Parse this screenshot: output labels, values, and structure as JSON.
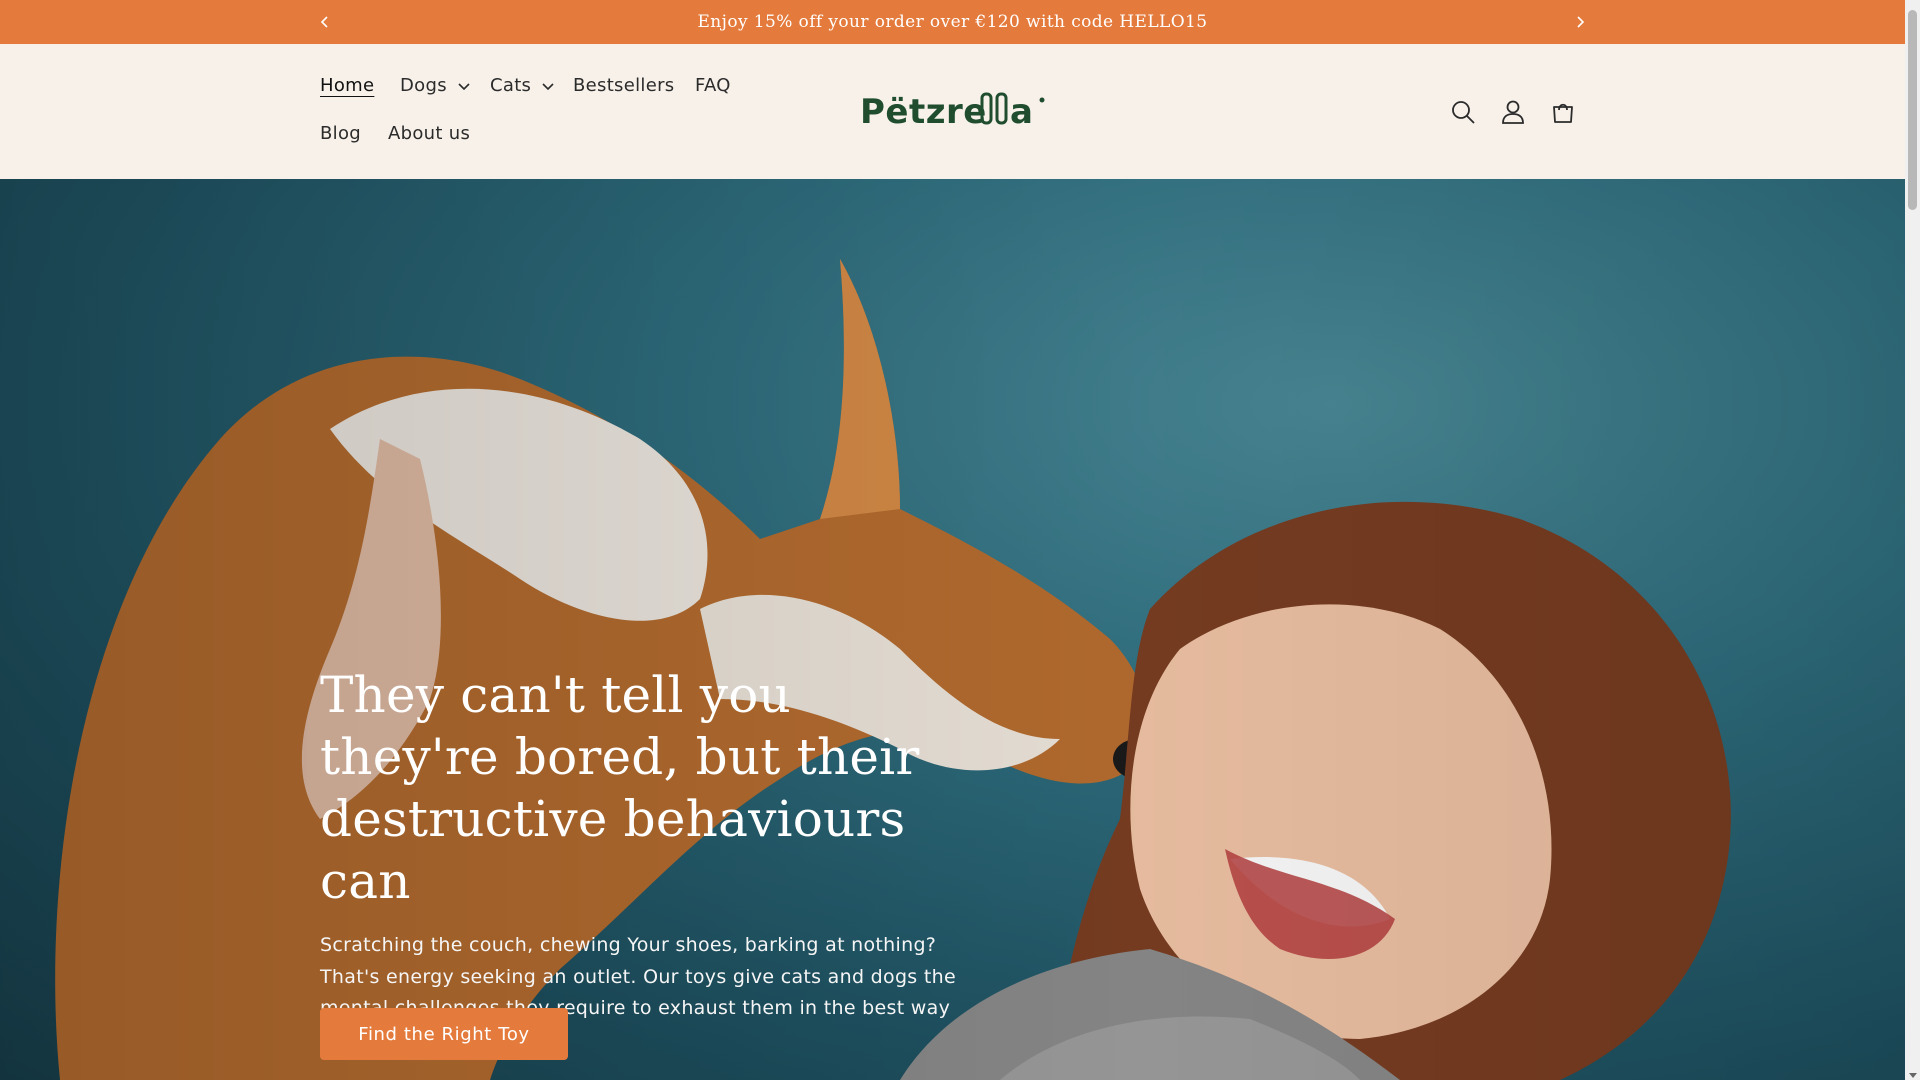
{
  "announcement": {
    "message": "Enjoy 15% off your order over €120 with code HELLO15"
  },
  "header": {
    "nav": [
      {
        "label": "Home",
        "active": true,
        "dropdown": false
      },
      {
        "label": "Dogs",
        "active": false,
        "dropdown": true
      },
      {
        "label": "Cats",
        "active": false,
        "dropdown": true
      },
      {
        "label": "Bestsellers",
        "active": false,
        "dropdown": false
      },
      {
        "label": "FAQ",
        "active": false,
        "dropdown": false
      },
      {
        "label": "Blog",
        "active": false,
        "dropdown": false
      },
      {
        "label": "About us",
        "active": false,
        "dropdown": false
      }
    ],
    "logo_text": "Pëtzrella",
    "icons": [
      "search-icon",
      "account-icon",
      "cart-icon"
    ]
  },
  "hero": {
    "title": "They can't tell you they're bored, but their destructive behaviours can",
    "subtitle": "Scratching the couch, chewing Your shoes, barking at nothing? That's energy seeking an outlet. Our toys give cats and dogs the mental challenges they require to exhaust them in the best way",
    "cta_label": "Find the Right Toy"
  },
  "colors": {
    "accent": "#e47b3c",
    "header_bg": "#f7f1ea",
    "logo_green": "#1f4d2e",
    "hero_teal": "#2f6f80"
  }
}
